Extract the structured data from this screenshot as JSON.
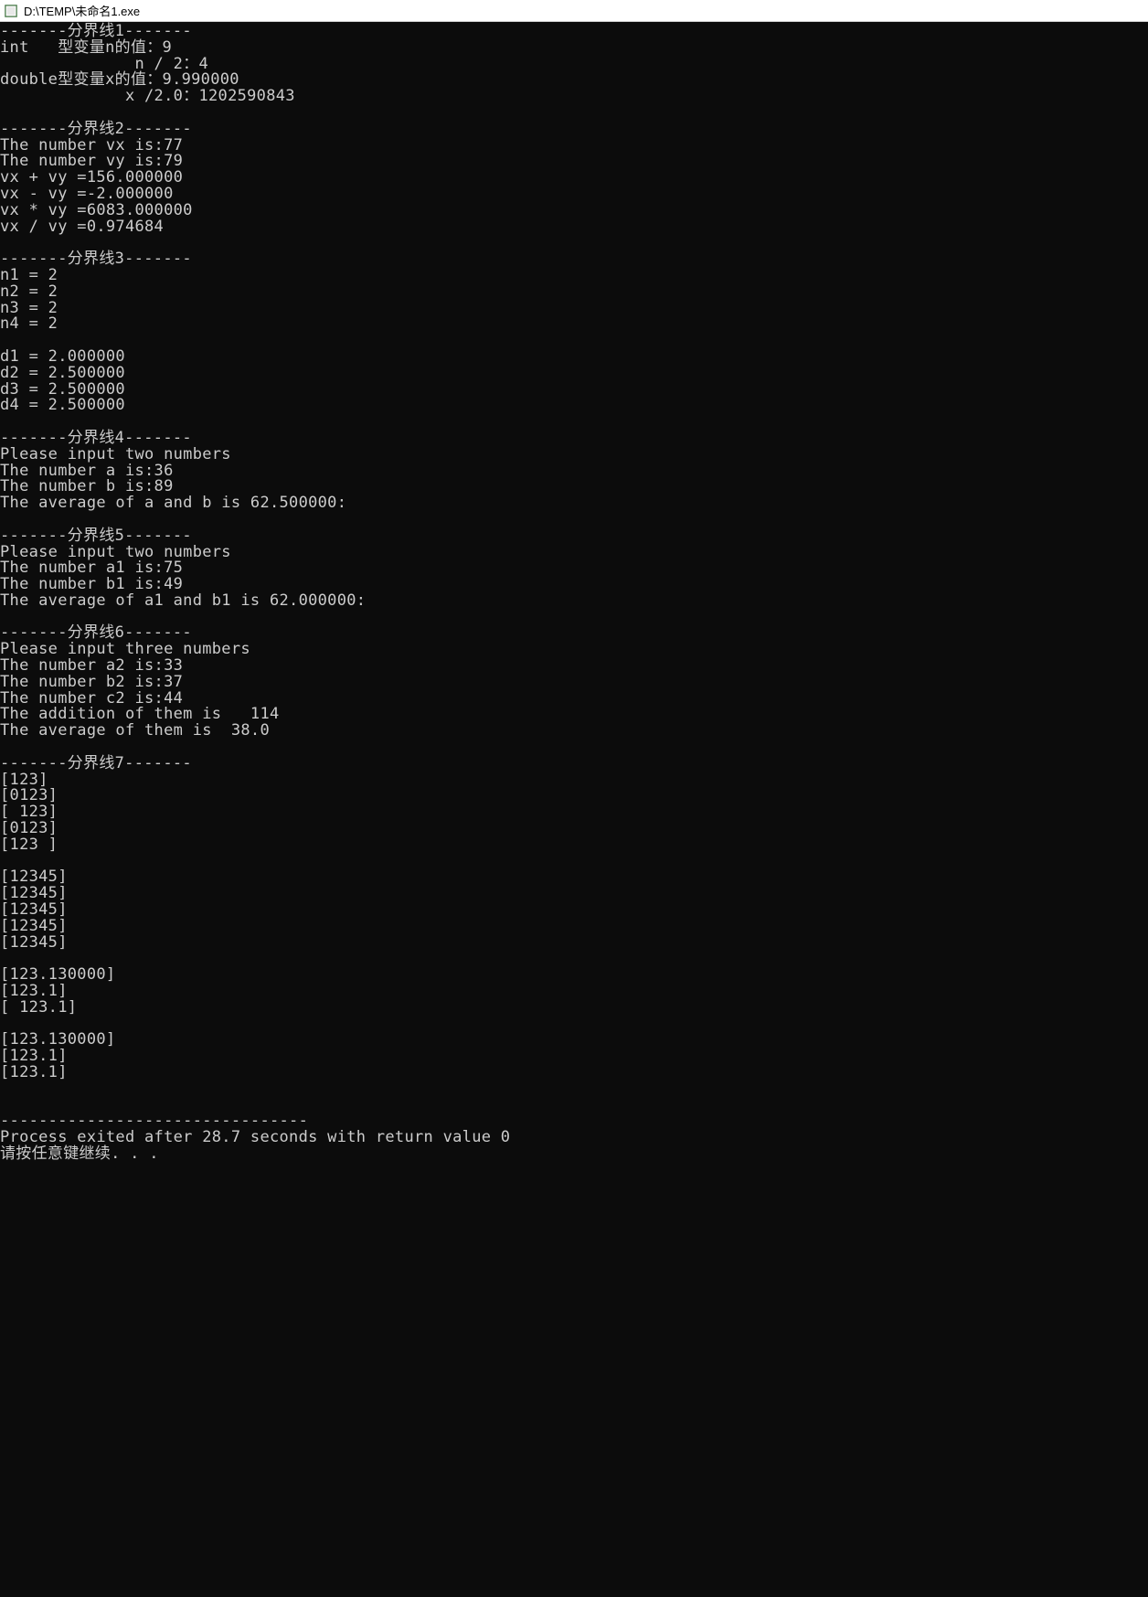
{
  "window": {
    "title": "D:\\TEMP\\未命名1.exe"
  },
  "lines": [
    "-------分界线1-------",
    "int   型变量n的值：9",
    "              n / 2：4",
    "double型变量x的值：9.990000",
    "             x /2.0：1202590843",
    "",
    "-------分界线2-------",
    "The number vx is:77",
    "The number vy is:79",
    "vx + vy =156.000000",
    "vx - vy =-2.000000",
    "vx * vy =6083.000000",
    "vx / vy =0.974684",
    "",
    "-------分界线3-------",
    "n1 = 2",
    "n2 = 2",
    "n3 = 2",
    "n4 = 2",
    "",
    "d1 = 2.000000",
    "d2 = 2.500000",
    "d3 = 2.500000",
    "d4 = 2.500000",
    "",
    "-------分界线4-------",
    "Please input two numbers",
    "The number a is:36",
    "The number b is:89",
    "The average of a and b is 62.500000:",
    "",
    "-------分界线5-------",
    "Please input two numbers",
    "The number a1 is:75",
    "The number b1 is:49",
    "The average of a1 and b1 is 62.000000:",
    "",
    "-------分界线6-------",
    "Please input three numbers",
    "The number a2 is:33",
    "The number b2 is:37",
    "The number c2 is:44",
    "The addition of them is   114",
    "The average of them is  38.0",
    "",
    "-------分界线7-------",
    "[123]",
    "[0123]",
    "[ 123]",
    "[0123]",
    "[123 ]",
    "",
    "[12345]",
    "[12345]",
    "[12345]",
    "[12345]",
    "[12345]",
    "",
    "[123.130000]",
    "[123.1]",
    "[ 123.1]",
    "",
    "[123.130000]",
    "[123.1]",
    "[123.1]",
    "",
    "",
    "--------------------------------",
    "Process exited after 28.7 seconds with return value 0",
    "请按任意键继续. . ."
  ]
}
